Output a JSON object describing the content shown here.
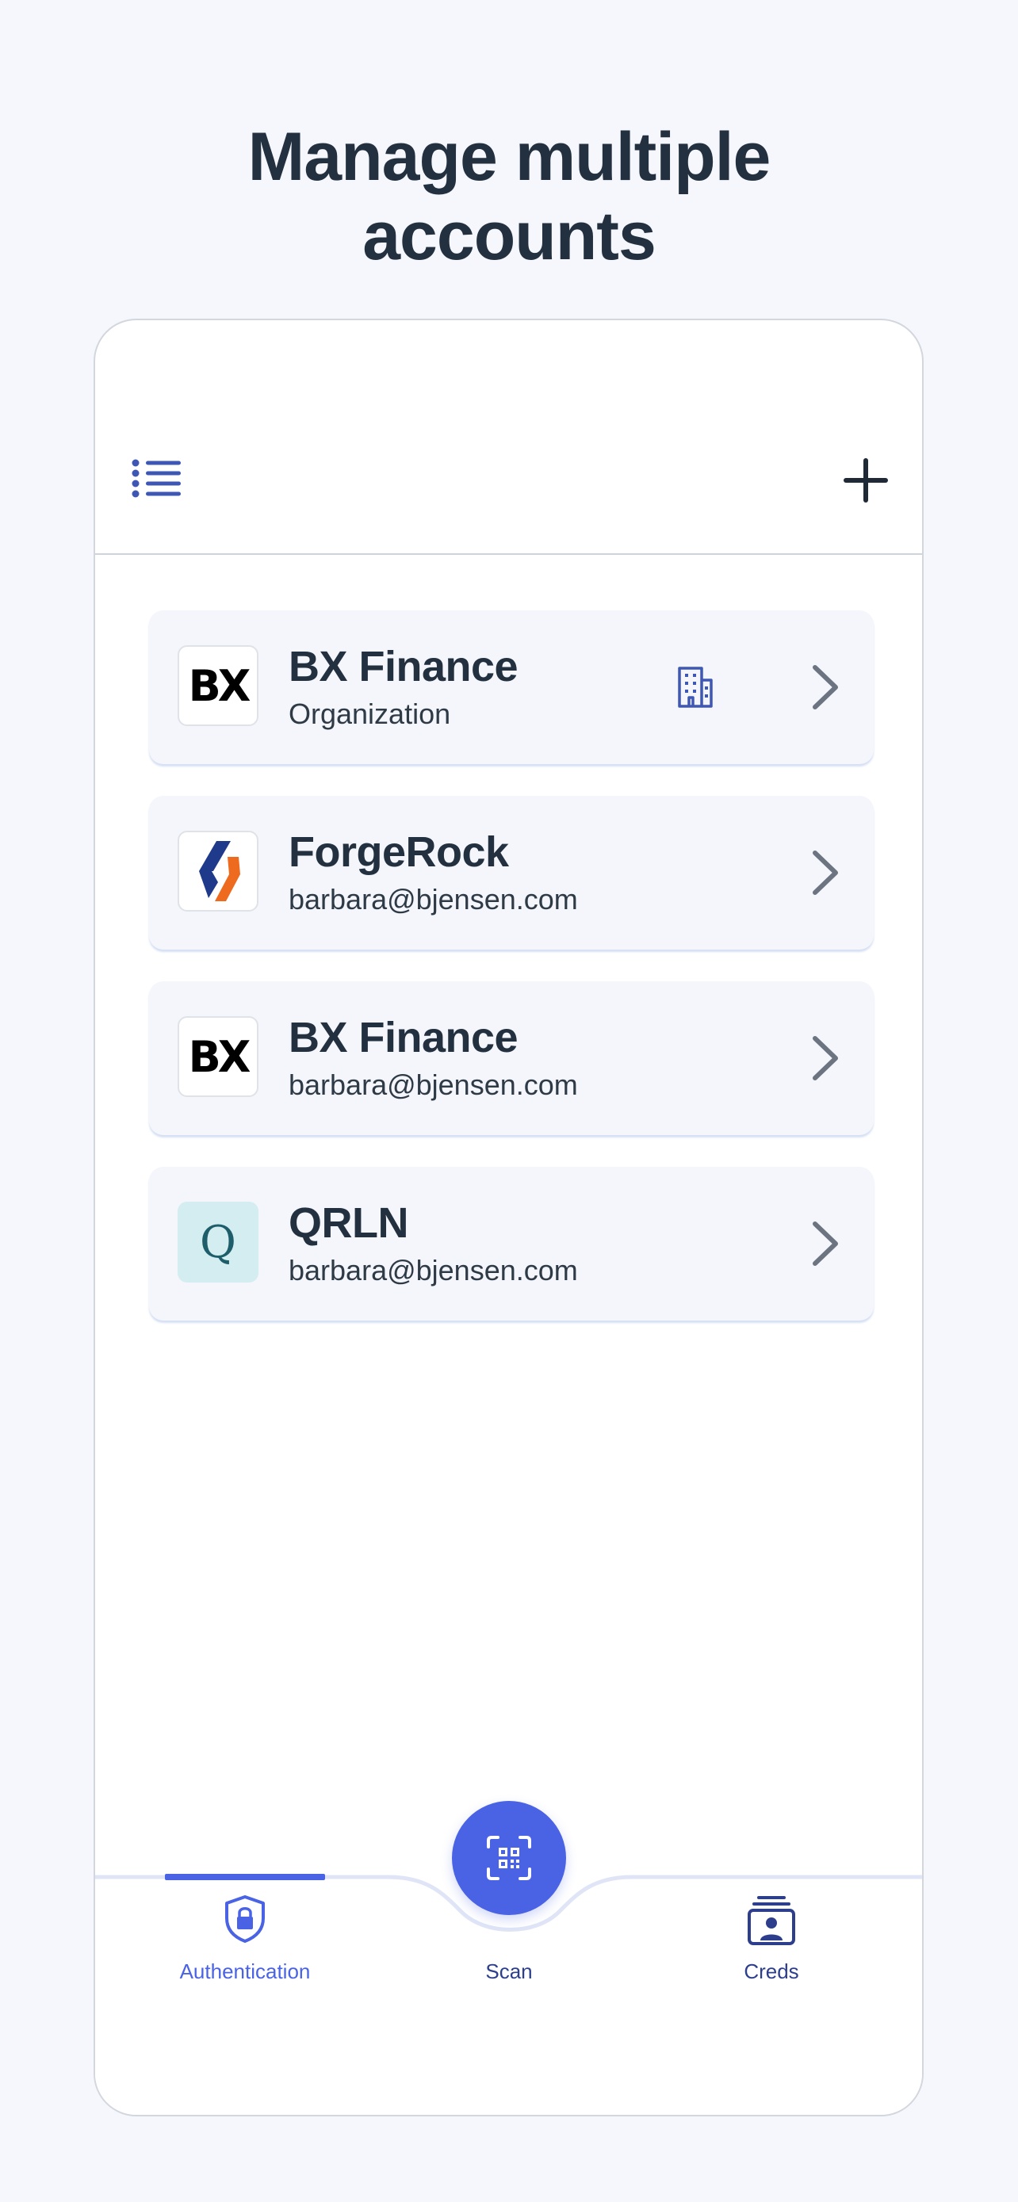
{
  "headline": {
    "line1": "Manage multiple",
    "line2": "accounts"
  },
  "toolbar": {
    "menu_icon": "list-icon",
    "add_icon": "plus-icon"
  },
  "accounts": [
    {
      "logo": "bx-finance-logo",
      "logo_text": "BX",
      "name": "BX Finance",
      "subtitle": "Organization",
      "badge_icon": "building-icon"
    },
    {
      "logo": "forgerock-logo",
      "logo_text": "",
      "name": "ForgeRock",
      "subtitle": "barbara@bjensen.com"
    },
    {
      "logo": "bx-finance-logo",
      "logo_text": "BX",
      "name": "BX Finance",
      "subtitle": "barbara@bjensen.com"
    },
    {
      "logo": "qrln-logo",
      "logo_text": "Q",
      "name": "QRLN",
      "subtitle": "barbara@bjensen.com"
    }
  ],
  "bottom_nav": {
    "items": [
      {
        "label": "Authentication",
        "icon": "shield-lock-icon",
        "active": true
      },
      {
        "label": "Scan",
        "icon": "qr-scan-icon",
        "active": false
      },
      {
        "label": "Creds",
        "icon": "id-card-icon",
        "active": false
      }
    ]
  },
  "colors": {
    "accent": "#4a63e4",
    "text": "#23303f",
    "background": "#f5f7fc",
    "nav_text": "#2d3f8c"
  }
}
